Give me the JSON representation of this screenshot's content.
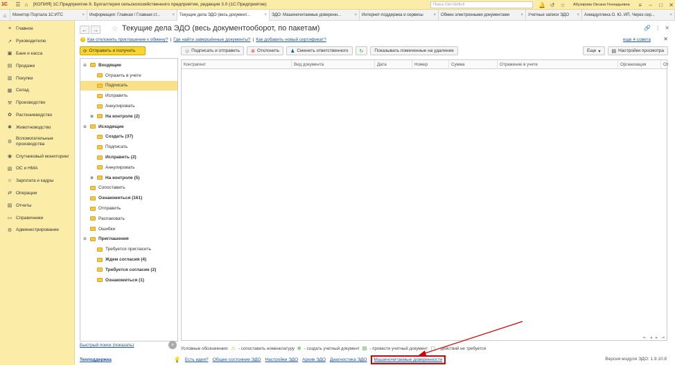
{
  "titlebar": {
    "logo": "1С",
    "title": "[КОПИЯ] 1С:Предприятие 8. Бухгалтерия сельскохозяйственного предприятия, редакция 3.0  (1С:Предприятие)",
    "search_placeholder": "Поиск Ctrl+Shift+F",
    "user": "Абузярова Оксана Геннадьевна"
  },
  "tabs": [
    {
      "label": "Монитор Портала 1С:ИТС",
      "active": false
    },
    {
      "label": "Информация: Главная / Главная ст...",
      "active": false
    },
    {
      "label": "Текущие дела ЭДО (весь документ...",
      "active": true
    },
    {
      "label": "ЭДО: Машиночитаемые доверенн...",
      "active": false
    },
    {
      "label": "Интернет-поддержка и сервисы",
      "active": false
    },
    {
      "label": "Обмен электронными документами",
      "active": false
    },
    {
      "label": "Учетные записи ЭДО",
      "active": false
    },
    {
      "label": "Ахмадуллина О. Ю. ИП, Через сер...",
      "active": false
    }
  ],
  "sidebar": {
    "items": [
      {
        "label": "Главное",
        "icon": "menu-icon"
      },
      {
        "label": "Руководителю",
        "icon": "chart-icon"
      },
      {
        "label": "Банк и касса",
        "icon": "bank-icon"
      },
      {
        "label": "Продажи",
        "icon": "cart-icon"
      },
      {
        "label": "Покупки",
        "icon": "basket-icon"
      },
      {
        "label": "Склад",
        "icon": "warehouse-icon"
      },
      {
        "label": "Производство",
        "icon": "factory-icon"
      },
      {
        "label": "Растениеводство",
        "icon": "plant-icon"
      },
      {
        "label": "Животноводство",
        "icon": "animal-icon"
      },
      {
        "label": "Вспомогательные производства",
        "icon": "gear-icon",
        "tall": true
      },
      {
        "label": "Спутниковый мониторинг",
        "icon": "satellite-icon"
      },
      {
        "label": "ОС и НМА",
        "icon": "assets-icon"
      },
      {
        "label": "Зарплата и кадры",
        "icon": "people-icon"
      },
      {
        "label": "Операции",
        "icon": "operations-icon"
      },
      {
        "label": "Отчеты",
        "icon": "report-icon"
      },
      {
        "label": "Справочники",
        "icon": "book-icon"
      },
      {
        "label": "Администрирование",
        "icon": "admin-icon"
      }
    ]
  },
  "main": {
    "title": "Текущие дела ЭДО (весь документооборот, по пакетам)",
    "link1": "Как отклонить приглашение к обмену?",
    "link2": "Где найти завершённые документы?",
    "link3": "Как добавить новый сертификат?",
    "more_link": "еще 4 совета",
    "send_button": "Отправить и получить",
    "toolbar": {
      "sign_send": "Подписать и отправить",
      "reject": "Отклонить",
      "change_responsible": "Сменить ответственного",
      "show_marked": "Показывать помеченные на удаление",
      "more": "Еще",
      "view_settings": "Настройки просмотра"
    },
    "tree": [
      {
        "label": "Входящие",
        "level": 0,
        "bold": true,
        "toggle": "⊖",
        "selected": false
      },
      {
        "label": "Отразить в учете",
        "level": 1,
        "bold": false,
        "selected": false
      },
      {
        "label": "Подписать",
        "level": 1,
        "bold": false,
        "selected": true
      },
      {
        "label": "Исправить",
        "level": 1,
        "bold": false,
        "selected": false
      },
      {
        "label": "Аннулировать",
        "level": 1,
        "bold": false,
        "selected": false
      },
      {
        "label": "На контроле (2)",
        "level": 1,
        "bold": true,
        "toggle": "⊕",
        "selected": false
      },
      {
        "label": "Исходящие",
        "level": 0,
        "bold": true,
        "toggle": "⊖",
        "selected": false
      },
      {
        "label": "Создать (37)",
        "level": 1,
        "bold": true,
        "selected": false
      },
      {
        "label": "Подписать",
        "level": 1,
        "bold": false,
        "selected": false
      },
      {
        "label": "Исправить (2)",
        "level": 1,
        "bold": true,
        "selected": false
      },
      {
        "label": "Аннулировать",
        "level": 1,
        "bold": false,
        "selected": false
      },
      {
        "label": "На контроле (5)",
        "level": 1,
        "bold": true,
        "toggle": "⊕",
        "selected": false
      },
      {
        "label": "Сопоставить",
        "level": 0,
        "bold": false,
        "selected": false
      },
      {
        "label": "Ознакомиться (161)",
        "level": 0,
        "bold": true,
        "selected": false
      },
      {
        "label": "Отправить",
        "level": 0,
        "bold": false,
        "selected": false
      },
      {
        "label": "Распаковать",
        "level": 0,
        "bold": false,
        "selected": false
      },
      {
        "label": "Ошибки",
        "level": 0,
        "bold": false,
        "selected": false
      },
      {
        "label": "Приглашения",
        "level": 0,
        "bold": true,
        "toggle": "⊖",
        "selected": false
      },
      {
        "label": "Требуется пригласить",
        "level": 1,
        "bold": false,
        "selected": false
      },
      {
        "label": "Ждем согласия (4)",
        "level": 1,
        "bold": true,
        "selected": false
      },
      {
        "label": "Требуется согласие (2)",
        "level": 1,
        "bold": true,
        "selected": false
      },
      {
        "label": "Ознакомиться (1)",
        "level": 1,
        "bold": true,
        "selected": false
      }
    ],
    "quick_search": "Быстрый поиск (показать)",
    "columns": [
      "Контрагент",
      "Вид документа",
      "Дата",
      "Номер",
      "Сумма",
      "Отражение в учете",
      "Организация",
      "От"
    ],
    "legend": {
      "title": "Условные обозначения:",
      "item1": "- сопоставить номенклатуру",
      "item2": "- создать учетный документ",
      "item3": "- провести учетный документ",
      "item4": "- действий не требуется"
    },
    "footer": {
      "support": "Техподдержка",
      "idea": "Есть идея?",
      "general_status": "Общее состояние ЭДО",
      "settings": "Настройки ЭДО",
      "archive": "Архив ЭДО",
      "diagnostics": "Диагностика ЭДО",
      "mchd": "Машиночитаемые доверенности",
      "version": "Версия модуля ЭДО: 1.9.10.8"
    }
  },
  "colors": {
    "sidebar_bg": "#fbeda7",
    "accent_yellow": "#f6d530",
    "link": "#1d55a5",
    "highlight_red": "#d40000"
  }
}
